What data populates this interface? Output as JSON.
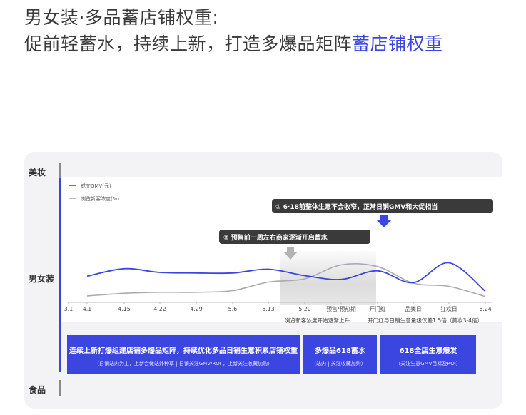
{
  "header": {
    "title_line1": "男女装·多品蓄店铺权重:",
    "title_line2_prefix": "促前轻蓄水，持续上新，打造多爆品矩阵",
    "title_line2_highlight": "蓄店铺权重"
  },
  "categories_side": {
    "top": "美妆",
    "middle": "男女装",
    "bottom": "食品"
  },
  "callouts": {
    "c1": "① 6·18前整体生意不会收窄，正常日销GMV和大促相当",
    "c2": "② 预售前一周左右商家逐渐开启蓄水"
  },
  "axis_notes": {
    "note1": "浏览新客浓度开始逐渐上升",
    "note2": "开门红与日销生意量级仅差1.5倍（美妆3-4倍）"
  },
  "bottom_boxes": [
    {
      "title": "连续上新打爆组建店铺多爆品矩阵，持续优化多品日销生意积累店铺权重",
      "sub": "（日销站内为主，上新会做站外种草 | 日销关注GMV/ROI ，上新关注收藏加购）"
    },
    {
      "title": "多爆品618蓄水",
      "sub": "(站内 | 关注收藏加购）"
    },
    {
      "title": "618全店生意爆发",
      "sub": "（关注生意GMV目标及ROI）"
    }
  ],
  "colors": {
    "accent": "#3b45e0",
    "series_gmv": "#3b45e0",
    "series_density": "#a9a9b6",
    "callout_bg": "#3a3a3a"
  },
  "chart_data": {
    "type": "line",
    "x": [
      "3.1",
      "4.1",
      "4.15",
      "4.22",
      "4.29",
      "5.6",
      "5.13",
      "5.20",
      "预售/预热期",
      "开门红",
      "品类日",
      "狂欢日",
      "6.24"
    ],
    "series": [
      {
        "name": "成交GMV(元)",
        "values": [
          null,
          24.5,
          31.5,
          28,
          27.5,
          27.5,
          31,
          25,
          21.5,
          29.5,
          18.5,
          37,
          10.5
        ]
      },
      {
        "name": "浏览新客浓度(%)",
        "values": [
          null,
          6,
          8.5,
          9.5,
          9.5,
          11,
          19,
          22,
          35,
          33.5,
          18,
          15,
          5.5
        ]
      }
    ],
    "shaded_region": [
      "5.13",
      "开门红"
    ],
    "legend_position": "top-left",
    "grid": false,
    "xlabel": "",
    "ylabel": ""
  }
}
